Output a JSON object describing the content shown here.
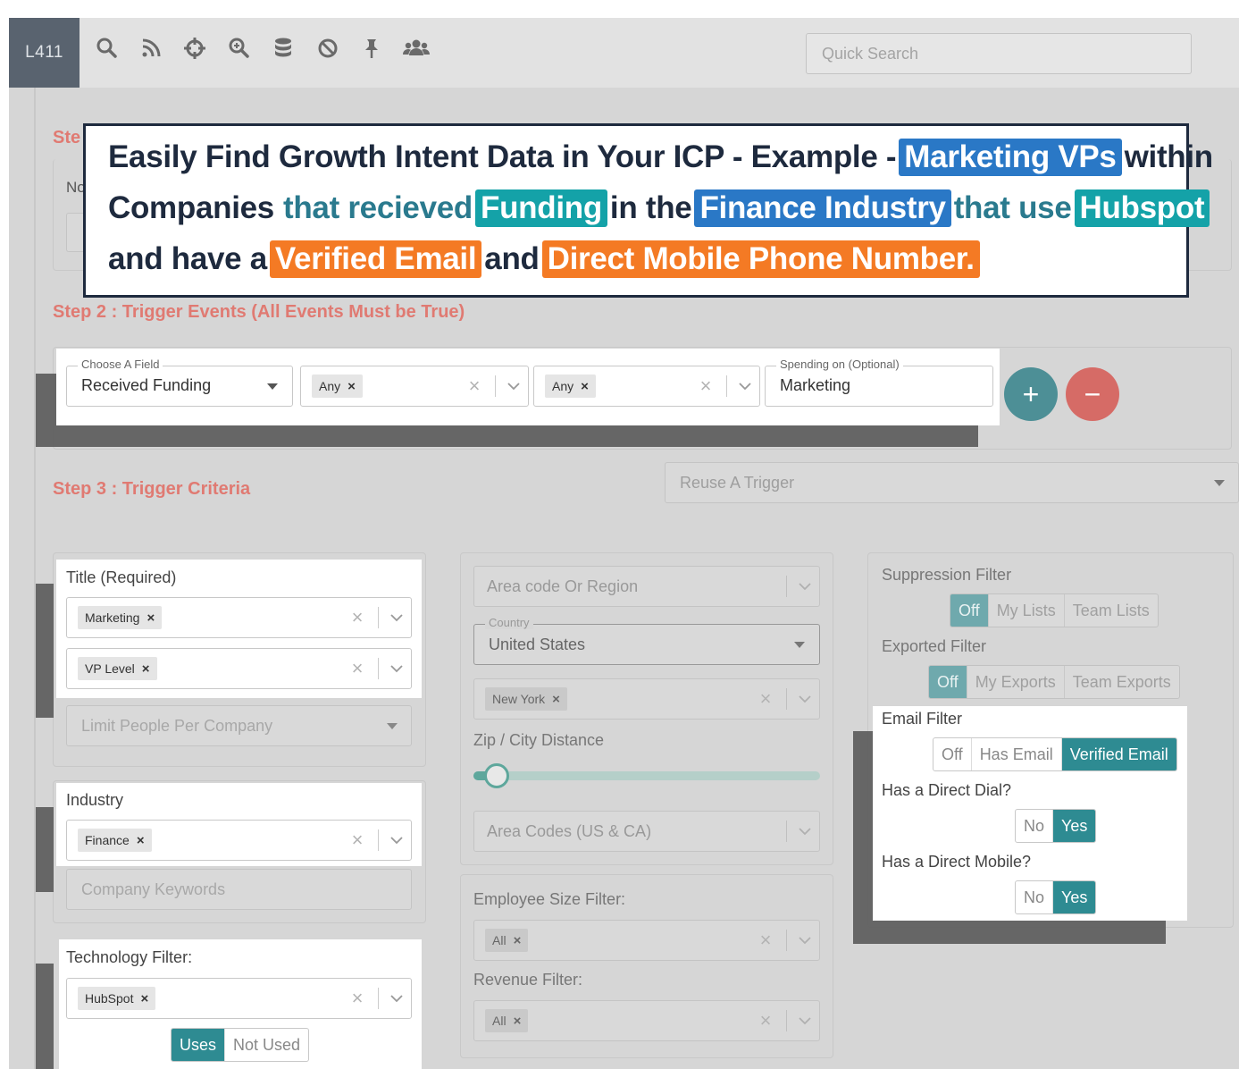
{
  "app": {
    "brand": "L411"
  },
  "toolbar": {
    "icons": [
      "search-icon",
      "rss-icon",
      "crosshair-icon",
      "zoom-in-icon",
      "database-icon",
      "ban-icon",
      "pin-icon",
      "users-icon"
    ],
    "quick_search_placeholder": "Quick Search"
  },
  "banner": {
    "line1_a": "Easily Find Growth Intent Data in Your ICP - Example -",
    "line1_hl": "Marketing VPs",
    "line1_b": "within",
    "line2_a": "Companies",
    "line2_b": "that recieved",
    "line2_hl1": "Funding",
    "line2_c": "in the",
    "line2_hl2": "Finance Industry",
    "line2_d": "that use",
    "line2_hl3": "Hubspot",
    "line3_a": "and have a",
    "line3_hl1": "Verified Email",
    "line3_b": "and",
    "line3_hl2": "Direct Mobile Phone Number.",
    "colors": {
      "blue": "#2a78c6",
      "teal": "#14a2a8",
      "orange": "#f47a24",
      "text": "#1e2a3e"
    }
  },
  "step1": {
    "label_partial": "Ste",
    "sub_partial": "No"
  },
  "step2": {
    "title": "Step 2 : Trigger Events (All Events Must be True)",
    "field_legend": "Choose A Field",
    "field_value": "Received Funding",
    "select1_tag": "Any",
    "select2_tag": "Any",
    "spending_legend": "Spending on (Optional)",
    "spending_value": "Marketing",
    "add_label": "+",
    "remove_label": "−"
  },
  "step3": {
    "title": "Step 3 : Trigger Criteria",
    "reuse_placeholder": "Reuse A Trigger",
    "title_label": "Title (Required)",
    "title_tags": [
      "Marketing",
      "VP Level"
    ],
    "limit_placeholder": "Limit People Per Company",
    "industry_label": "Industry",
    "industry_tag": "Finance",
    "keywords_placeholder": "Company Keywords",
    "tech_label": "Technology Filter:",
    "tech_tag": "HubSpot",
    "tech_uses": "Uses",
    "tech_not_used": "Not Used",
    "area_placeholder": "Area code Or Region",
    "country_legend": "Country",
    "country_value": "United States",
    "state_tag": "New York",
    "zip_label": "Zip / City Distance",
    "slider_value": 0.03,
    "area_codes_placeholder": "Area Codes (US & CA)",
    "emp_label": "Employee Size Filter:",
    "emp_tag": "All",
    "rev_label": "Revenue Filter:",
    "rev_tag": "All",
    "suppression_label": "Suppression Filter",
    "suppression_options": [
      "Off",
      "My Lists",
      "Team Lists"
    ],
    "exported_label": "Exported Filter",
    "exported_options": [
      "Off",
      "My Exports",
      "Team Exports"
    ],
    "email_label": "Email Filter",
    "email_options": [
      "Off",
      "Has Email",
      "Verified Email"
    ],
    "dial_label": "Has a Direct Dial?",
    "dial_options": [
      "No",
      "Yes"
    ],
    "mobile_label": "Has a Direct Mobile?",
    "mobile_options": [
      "No",
      "Yes"
    ]
  },
  "colors": {
    "accent": "#2e8b92",
    "step_heading": "#e07a72",
    "add_button": "#4d8f96",
    "remove_button": "#d66b66"
  }
}
